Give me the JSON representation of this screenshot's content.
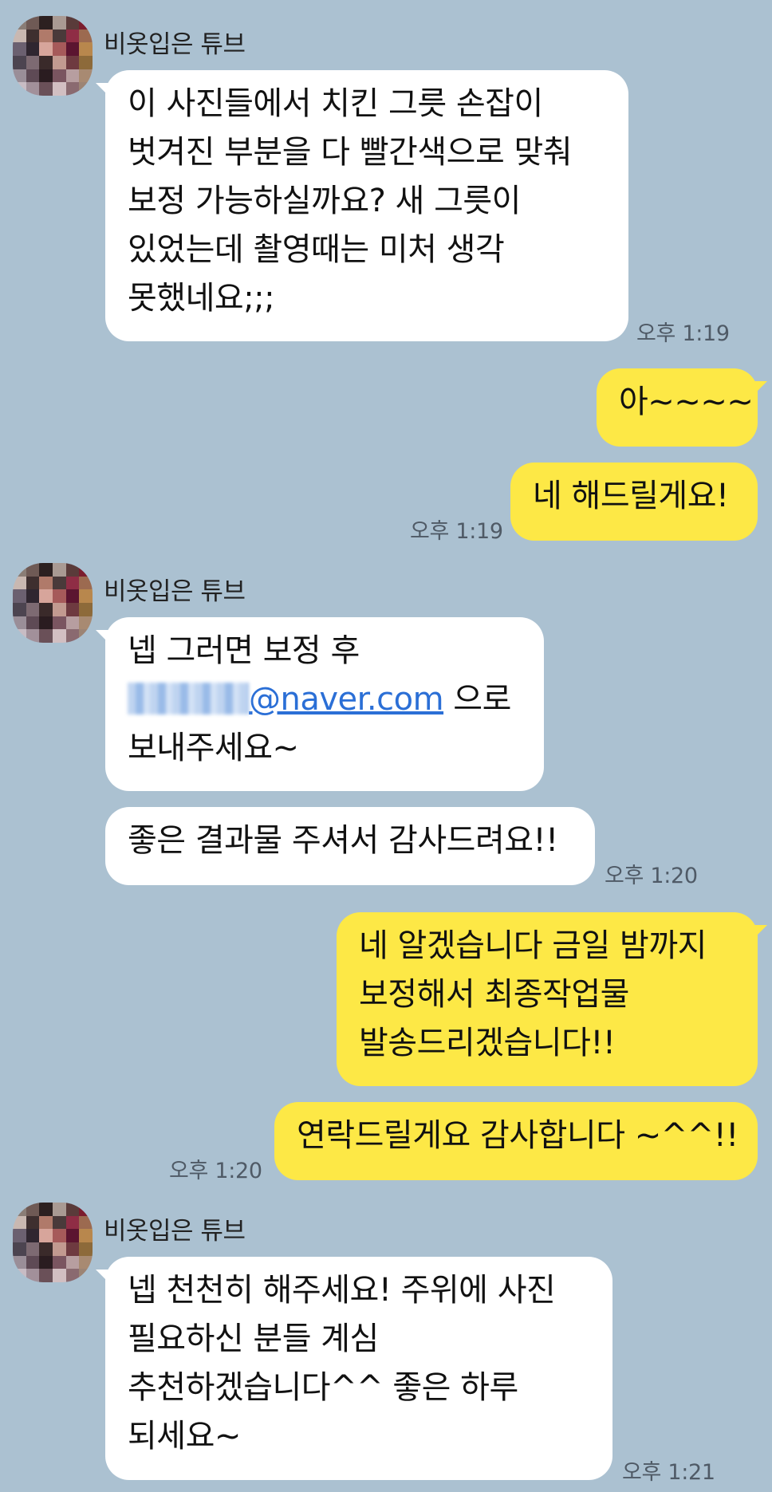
{
  "chat": {
    "sender_name": "비옷입은 튜브",
    "groups": [
      {
        "sender": "비옷입은 튜브",
        "messages": [
          {
            "lines": [
              "이 사진들에서 치킨 그릇 손잡이",
              "벗겨진 부분을 다 빨간색으로 맞춰",
              "보정 가능하실까요?  새 그릇이",
              "있었는데 촬영때는 미처 생각",
              "못했네요;;;"
            ]
          }
        ],
        "time": "오후 1:19"
      },
      {
        "sender": "me",
        "messages": [
          {
            "lines": [
              "아~~~~"
            ]
          },
          {
            "lines": [
              "네 해드릴게요!"
            ]
          }
        ],
        "time": "오후 1:19"
      },
      {
        "sender": "비옷입은 튜브",
        "messages": [
          {
            "lines": [
              "넵 그러면 보정 후",
              "@naver.com 으로",
              "보내주세요~"
            ],
            "email_domain": "@naver.com",
            "after_email": " 으로"
          },
          {
            "lines": [
              "좋은 결과물 주셔서 감사드려요!!"
            ]
          }
        ],
        "time": "오후 1:20"
      },
      {
        "sender": "me",
        "messages": [
          {
            "lines": [
              "네 알겠습니다 금일 밤까지",
              "보정해서 최종작업물",
              "발송드리겠습니다!!"
            ]
          },
          {
            "lines": [
              "연락드릴게요 감사합니다 ~^^!!"
            ]
          }
        ],
        "time": "오후 1:20"
      },
      {
        "sender": "비옷입은 튜브",
        "messages": [
          {
            "lines": [
              "넵 천천히 해주세요!  주위에 사진",
              "필요하신 분들 계심",
              "추천하겠습니다^^  좋은 하루",
              "되세요~"
            ]
          }
        ],
        "time": "오후 1:21"
      }
    ]
  },
  "colors": {
    "background": "#abc1d1",
    "incoming_bubble": "#ffffff",
    "outgoing_bubble": "#fde846",
    "link": "#2b6fd6"
  },
  "icons": {
    "avatar": "avatar-pixelated-icon"
  }
}
